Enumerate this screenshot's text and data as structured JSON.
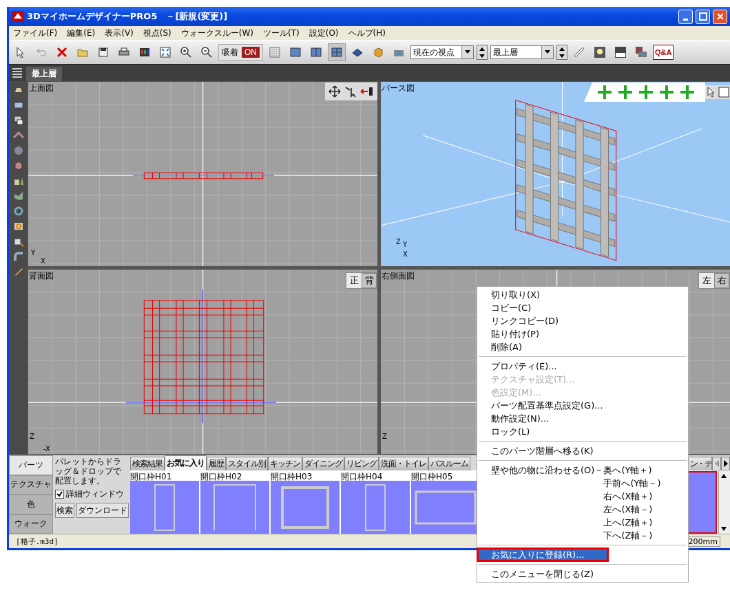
{
  "window": {
    "title": "3DマイホームデザイナーPRO5　－[新規(変更)]"
  },
  "menu": [
    "ファイル(F)",
    "編集(E)",
    "表示(V)",
    "視点(S)",
    "ウォークスルー(W)",
    "ツール(T)",
    "設定(O)",
    "ヘルプ(H)"
  ],
  "toolbar": {
    "snap": {
      "label": "吸着",
      "state": "ON",
      "on": true
    },
    "layouts": [
      {
        "selected": false
      },
      {
        "selected": false
      },
      {
        "selected": false
      },
      {
        "selected": true
      }
    ],
    "viewpoint": "現在の視点",
    "floor": "最上層",
    "help": "Q&A"
  },
  "layer_tabs": [
    {
      "label": "最上層",
      "selected": true
    }
  ],
  "viewports": [
    {
      "kind": "top",
      "title": "上面図",
      "axes": [
        "Y",
        "X"
      ]
    },
    {
      "kind": "perspective",
      "title": "パース図",
      "axes": [
        "Z",
        "Y",
        "X"
      ]
    },
    {
      "kind": "back",
      "title": "背面図",
      "axes": [
        "Z",
        "-X"
      ],
      "toggle": [
        {
          "label": "正",
          "selected": false
        },
        {
          "label": "背",
          "selected": true
        }
      ]
    },
    {
      "kind": "side",
      "title": "右側面図",
      "axes": [
        "Z"
      ],
      "toggle": [
        {
          "label": "左",
          "selected": false
        },
        {
          "label": "右",
          "selected": true
        }
      ]
    }
  ],
  "palette": {
    "side_tabs": [
      {
        "label": "パーツ",
        "selected": true
      },
      {
        "label": "テクスチャ",
        "selected": false
      },
      {
        "label": "色",
        "selected": false
      },
      {
        "label": "ウォーク",
        "selected": false
      }
    ],
    "hint": "パレットからドラッグ＆ドロップで配置します。",
    "detail_window": {
      "label": "詳細ウィンドウ",
      "checked": true
    },
    "buttons": [
      "検索",
      "ダウンロード"
    ],
    "tabs": [
      {
        "label": "検索結果",
        "selected": false
      },
      {
        "label": "お気に入り",
        "selected": true
      },
      {
        "label": "履歴",
        "selected": false
      },
      {
        "label": "スタイル別",
        "selected": false
      },
      {
        "label": "キッチン",
        "selected": false
      },
      {
        "label": "ダイニング",
        "selected": false
      },
      {
        "label": "リビング",
        "selected": false
      },
      {
        "label": "洗面・トイレ",
        "selected": false
      },
      {
        "label": "バスルーム",
        "selected": false
      },
      {
        "label": "ン・テ",
        "selected": false
      }
    ],
    "items": [
      {
        "label": "開口枠H01",
        "kind": "tall",
        "selected": false
      },
      {
        "label": "開口枠H02",
        "kind": "door",
        "selected": false
      },
      {
        "label": "開口枠H03",
        "kind": "square",
        "selected": false
      },
      {
        "label": "開口枠H04",
        "kind": "tall",
        "selected": false
      },
      {
        "label": "開口枠H05",
        "kind": "wide",
        "selected": false
      },
      {
        "kind": "lattice",
        "selected": true
      }
    ]
  },
  "status_bar": {
    "file": "[格子.m3d]",
    "scale": "200mm"
  },
  "context_menu": {
    "entries": [
      {
        "kind": "item",
        "label": "切り取り(X)",
        "disabled": false,
        "selected": false
      },
      {
        "kind": "item",
        "label": "コピー(C)",
        "disabled": false,
        "selected": false
      },
      {
        "kind": "item",
        "label": "リンクコピー(D)",
        "disabled": false,
        "selected": false
      },
      {
        "kind": "item",
        "label": "貼り付け(P)",
        "disabled": false,
        "selected": false
      },
      {
        "kind": "item",
        "label": "削除(A)",
        "disabled": false,
        "selected": false
      },
      {
        "kind": "separator"
      },
      {
        "kind": "item",
        "label": "プロパティ(E)...",
        "disabled": false,
        "selected": false
      },
      {
        "kind": "item",
        "label": "テクスチャ設定(T)...",
        "disabled": true,
        "selected": false
      },
      {
        "kind": "item",
        "label": "色設定(M)...",
        "disabled": true,
        "selected": false
      },
      {
        "kind": "item",
        "label": "パーツ配置基準点設定(G)...",
        "disabled": false,
        "selected": false
      },
      {
        "kind": "item",
        "label": "動作設定(N)...",
        "disabled": false,
        "selected": false
      },
      {
        "kind": "item",
        "label": "ロック(L)",
        "disabled": false,
        "selected": false
      },
      {
        "kind": "separator"
      },
      {
        "kind": "item",
        "label": "このパーツ階層へ移る(K)",
        "disabled": false,
        "selected": false
      },
      {
        "kind": "separator"
      },
      {
        "kind": "group",
        "label": "壁や他の物に沿わせる(O)－",
        "options": [
          "奥へ(Y軸＋)",
          "手前へ(Y軸－)",
          "右へ(X軸＋)",
          "左へ(X軸－)",
          "上へ(Z軸＋)",
          "下へ(Z軸－)"
        ]
      },
      {
        "kind": "separator"
      },
      {
        "kind": "item",
        "label": "お気に入りに登録(R)...",
        "disabled": false,
        "selected": true,
        "callout": true
      },
      {
        "kind": "separator"
      },
      {
        "kind": "item",
        "label": "このメニューを閉じる(Z)",
        "disabled": false,
        "selected": false
      }
    ]
  }
}
